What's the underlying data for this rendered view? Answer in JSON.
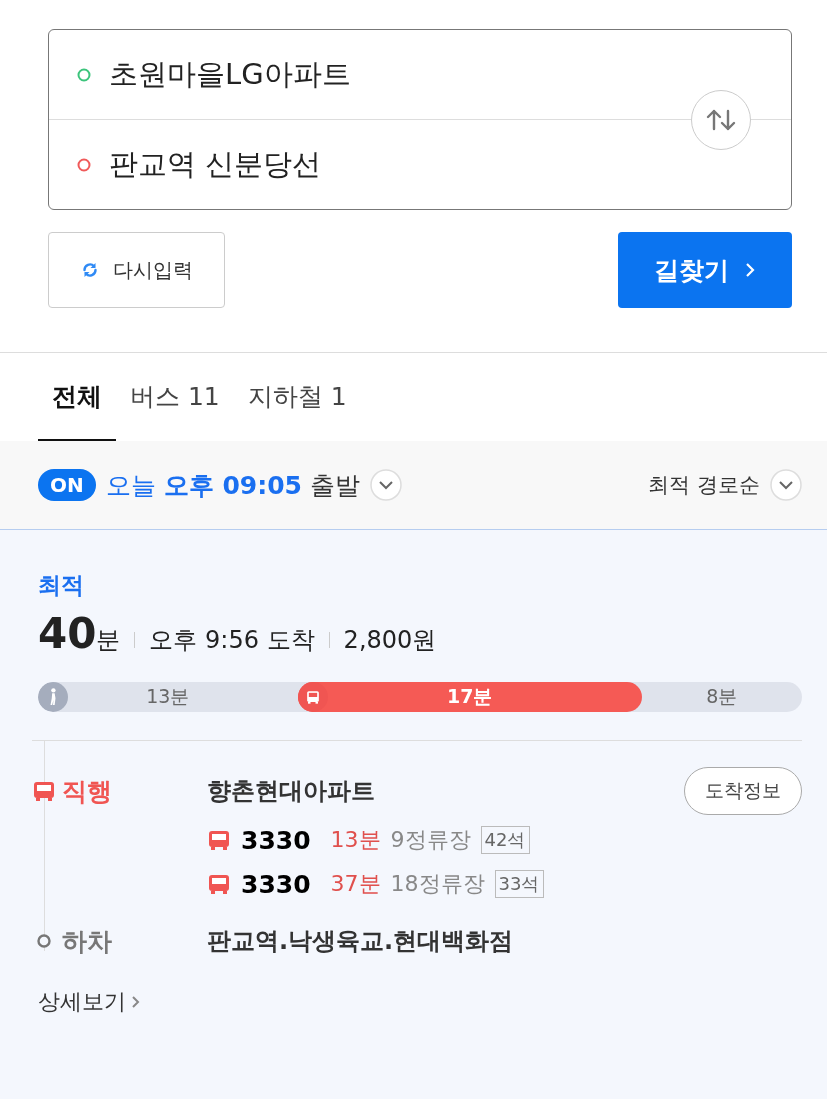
{
  "route_inputs": [
    {
      "kind": "origin",
      "value": "초원마을LG아파트"
    },
    {
      "kind": "destination",
      "value": "판교역 신분당선"
    }
  ],
  "reset_button": "다시입력",
  "search_button": "길찾기",
  "tabs": [
    {
      "label": "전체",
      "selected": true
    },
    {
      "label": "버스 11",
      "selected": false
    },
    {
      "label": "지하철 1",
      "selected": false
    }
  ],
  "departure": {
    "on": true,
    "toggle_label": "ON",
    "day": "오늘",
    "time": "오후 09:05",
    "suffix": "출발"
  },
  "sort": "최적 경로순",
  "route": {
    "badge": "최적",
    "minutes": "40",
    "minutes_unit": "분",
    "arrival": "오후 9:56 도착",
    "fare": "2,800원",
    "segments": [
      {
        "kind": "walk",
        "label": "13분"
      },
      {
        "kind": "bus",
        "label": "17분"
      },
      {
        "kind": "walk",
        "label": "8분"
      }
    ],
    "steps": [
      {
        "kind": "board",
        "label": "직행",
        "stop": "향촌현대아파트",
        "button": "도착정보",
        "buses": [
          {
            "number": "3330",
            "wait": "13분",
            "stops": "9정류장",
            "seats": "42석"
          },
          {
            "number": "3330",
            "wait": "37분",
            "stops": "18정류장",
            "seats": "33석"
          }
        ]
      },
      {
        "kind": "alight",
        "label": "하차",
        "stop": "판교역.낙생육교.현대백화점"
      }
    ],
    "details_link": "상세보기"
  }
}
